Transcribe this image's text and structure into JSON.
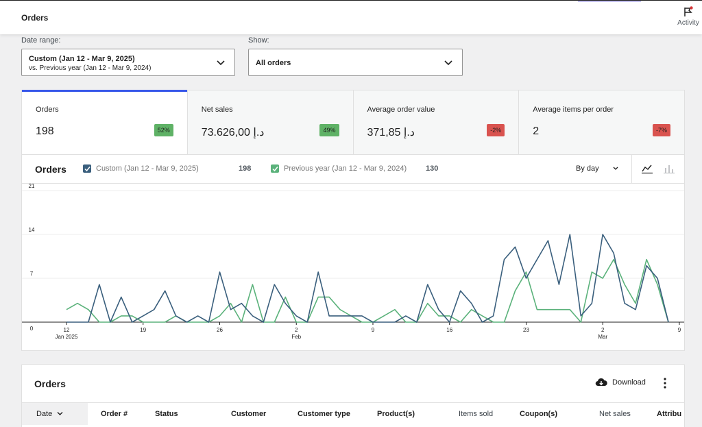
{
  "header": {
    "title": "Orders",
    "activity_label": "Activity"
  },
  "filters": {
    "date_range_label": "Date range:",
    "date_range_main": "Custom (Jan 12 - Mar 9, 2025)",
    "date_range_sub": "vs. Previous year (Jan 12 - Mar 9, 2024)",
    "show_label": "Show:",
    "show_value": "All orders"
  },
  "summary": [
    {
      "label": "Orders",
      "value": "198",
      "delta": "52%",
      "trend": "up",
      "active": true
    },
    {
      "label": "Net sales",
      "value": "73.626,00 د.إ",
      "delta": "49%",
      "trend": "up"
    },
    {
      "label": "Average order value",
      "value": "371,85 د.إ",
      "delta": "-2%",
      "trend": "down"
    },
    {
      "label": "Average items per order",
      "value": "2",
      "delta": "-7%",
      "trend": "down"
    }
  ],
  "chart_header": {
    "title": "Orders",
    "interval": "By day"
  },
  "colors": {
    "current": "#3a5f7d",
    "previous": "#5bb27b",
    "accent": "#3858e9"
  },
  "chart_data": {
    "type": "line",
    "ylim": [
      0,
      21
    ],
    "y_ticks": [
      0,
      7,
      14,
      21
    ],
    "x_ticks": [
      {
        "day": 0,
        "label": "12",
        "sub": "Jan 2025"
      },
      {
        "day": 7,
        "label": "19",
        "sub": ""
      },
      {
        "day": 14,
        "label": "26",
        "sub": ""
      },
      {
        "day": 21,
        "label": "2",
        "sub": "Feb"
      },
      {
        "day": 28,
        "label": "9",
        "sub": ""
      },
      {
        "day": 35,
        "label": "16",
        "sub": ""
      },
      {
        "day": 42,
        "label": "23",
        "sub": ""
      },
      {
        "day": 49,
        "label": "2",
        "sub": "Mar"
      },
      {
        "day": 56,
        "label": "9",
        "sub": ""
      }
    ],
    "series": [
      {
        "name": "Custom (Jan 12 - Mar 9, 2025)",
        "total": "198",
        "values": [
          0,
          0,
          0,
          6,
          0,
          4,
          0,
          1,
          2,
          5,
          1,
          0,
          1,
          0,
          8,
          2,
          3,
          1,
          0,
          6,
          3,
          1,
          0,
          8,
          1,
          1,
          1,
          1,
          0,
          0,
          0,
          1,
          0,
          6,
          2,
          0,
          5,
          3,
          0,
          1,
          10,
          12,
          7,
          10,
          13,
          6,
          14,
          1,
          3,
          14,
          11,
          3,
          2,
          9,
          7,
          0
        ]
      },
      {
        "name": "Previous year (Jan 12 - Mar 9, 2024)",
        "total": "130",
        "values": [
          2,
          3,
          2,
          0,
          0,
          1,
          1,
          0,
          0,
          0,
          1,
          0,
          0,
          0,
          1,
          3,
          0,
          6,
          0,
          0,
          4,
          0,
          0,
          4,
          4,
          2,
          1,
          0,
          0,
          1,
          2,
          0,
          0,
          3,
          1,
          1,
          0,
          2,
          1,
          0,
          0,
          5,
          8,
          2,
          2,
          2,
          2,
          0,
          8,
          7,
          10,
          6,
          3,
          10,
          6,
          0
        ]
      }
    ]
  },
  "orders_table": {
    "title": "Orders",
    "download_label": "Download",
    "columns": [
      "Date",
      "Order #",
      "Status",
      "Customer",
      "Customer type",
      "Product(s)",
      "Items sold",
      "Coupon(s)",
      "Net sales",
      "Attribu"
    ]
  }
}
